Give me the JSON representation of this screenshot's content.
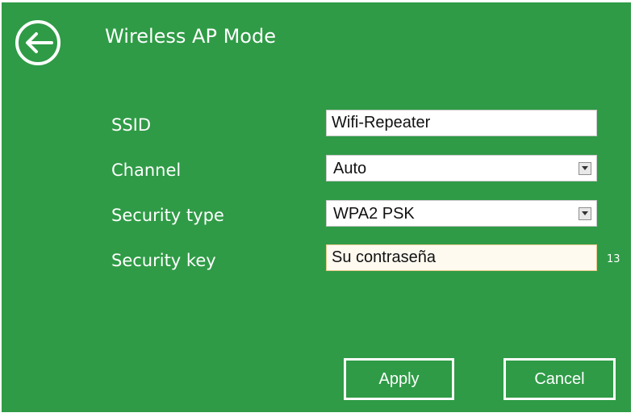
{
  "header": {
    "title": "Wireless AP Mode",
    "back_icon": "back-arrow-circle-icon"
  },
  "form": {
    "ssid_label": "SSID",
    "ssid_value": "Wifi-Repeater",
    "channel_label": "Channel",
    "channel_value": "Auto",
    "security_type_label": "Security type",
    "security_type_value": "WPA2 PSK",
    "security_key_label": "Security key",
    "security_key_value": "Su contraseña",
    "security_key_count": "13"
  },
  "buttons": {
    "apply": "Apply",
    "cancel": "Cancel"
  },
  "colors": {
    "background": "#2f9b46",
    "text": "#ffffff",
    "field": "#ffffff"
  }
}
